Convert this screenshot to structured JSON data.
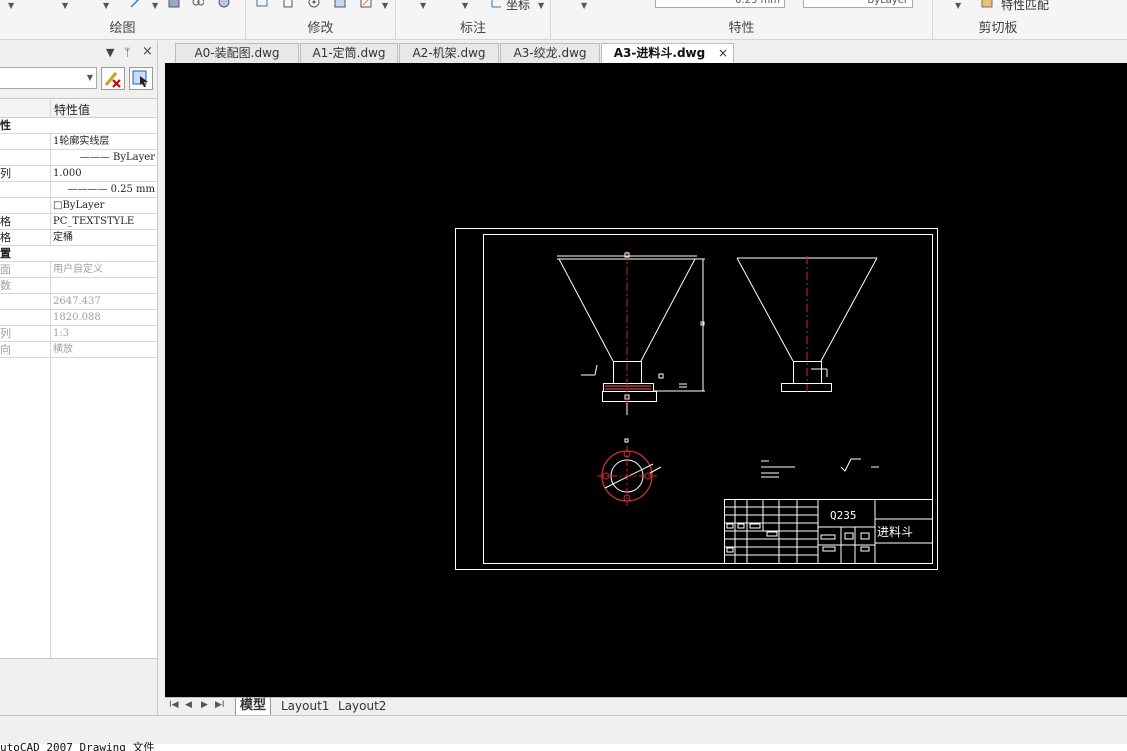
{
  "ribbon": {
    "groups": [
      {
        "label": "绘图"
      },
      {
        "label": "修改"
      },
      {
        "label": "标注"
      },
      {
        "label": "特性"
      },
      {
        "label": "剪切板"
      }
    ],
    "coordinate_label": "坐标",
    "lineweight_value": "0.25 mm",
    "bylayer_value": "ByLayer",
    "match_properties_label": "特性匹配"
  },
  "panel": {
    "header_value": "特性值",
    "rows": [
      {
        "name": "性",
        "value": "",
        "kind": "cat"
      },
      {
        "name": "",
        "value": "1轮廓实线层",
        "kind": "row"
      },
      {
        "name": "",
        "value": "——— ByLayer",
        "kind": "row"
      },
      {
        "name": "列",
        "value": "1.000",
        "kind": "row"
      },
      {
        "name": "",
        "value": "———— 0.25 mm",
        "kind": "row"
      },
      {
        "name": "",
        "value": "□ByLayer",
        "kind": "row"
      },
      {
        "name": "格",
        "value": "PC_TEXTSTYLE",
        "kind": "row"
      },
      {
        "name": "格",
        "value": "定桶",
        "kind": "row"
      },
      {
        "name": "置",
        "value": "",
        "kind": "cat"
      },
      {
        "name": "面",
        "value": "用户自定义",
        "kind": "dim"
      },
      {
        "name": "数",
        "value": "",
        "kind": "dim"
      },
      {
        "name": "",
        "value": "2647.437",
        "kind": "dim"
      },
      {
        "name": "",
        "value": "1820.088",
        "kind": "dim"
      },
      {
        "name": "列",
        "value": "1:3",
        "kind": "dim"
      },
      {
        "name": "向",
        "value": "横放",
        "kind": "dim"
      }
    ]
  },
  "tabs": [
    {
      "label": "A0-装配图.dwg",
      "active": false
    },
    {
      "label": "A1-定筒.dwg",
      "active": false
    },
    {
      "label": "A2-机架.dwg",
      "active": false
    },
    {
      "label": "A3-绞龙.dwg",
      "active": false
    },
    {
      "label": "A3-进料斗.dwg",
      "active": true
    }
  ],
  "tab_close": "×",
  "drawing": {
    "material": "Q235",
    "part_name": "进料斗"
  },
  "layout_tabs": [
    {
      "label": "模型",
      "active": true
    },
    {
      "label": "Layout1",
      "active": false
    },
    {
      "label": "Layout2",
      "active": false
    }
  ],
  "command_line": "utoCAD 2007 Drawing 文件"
}
